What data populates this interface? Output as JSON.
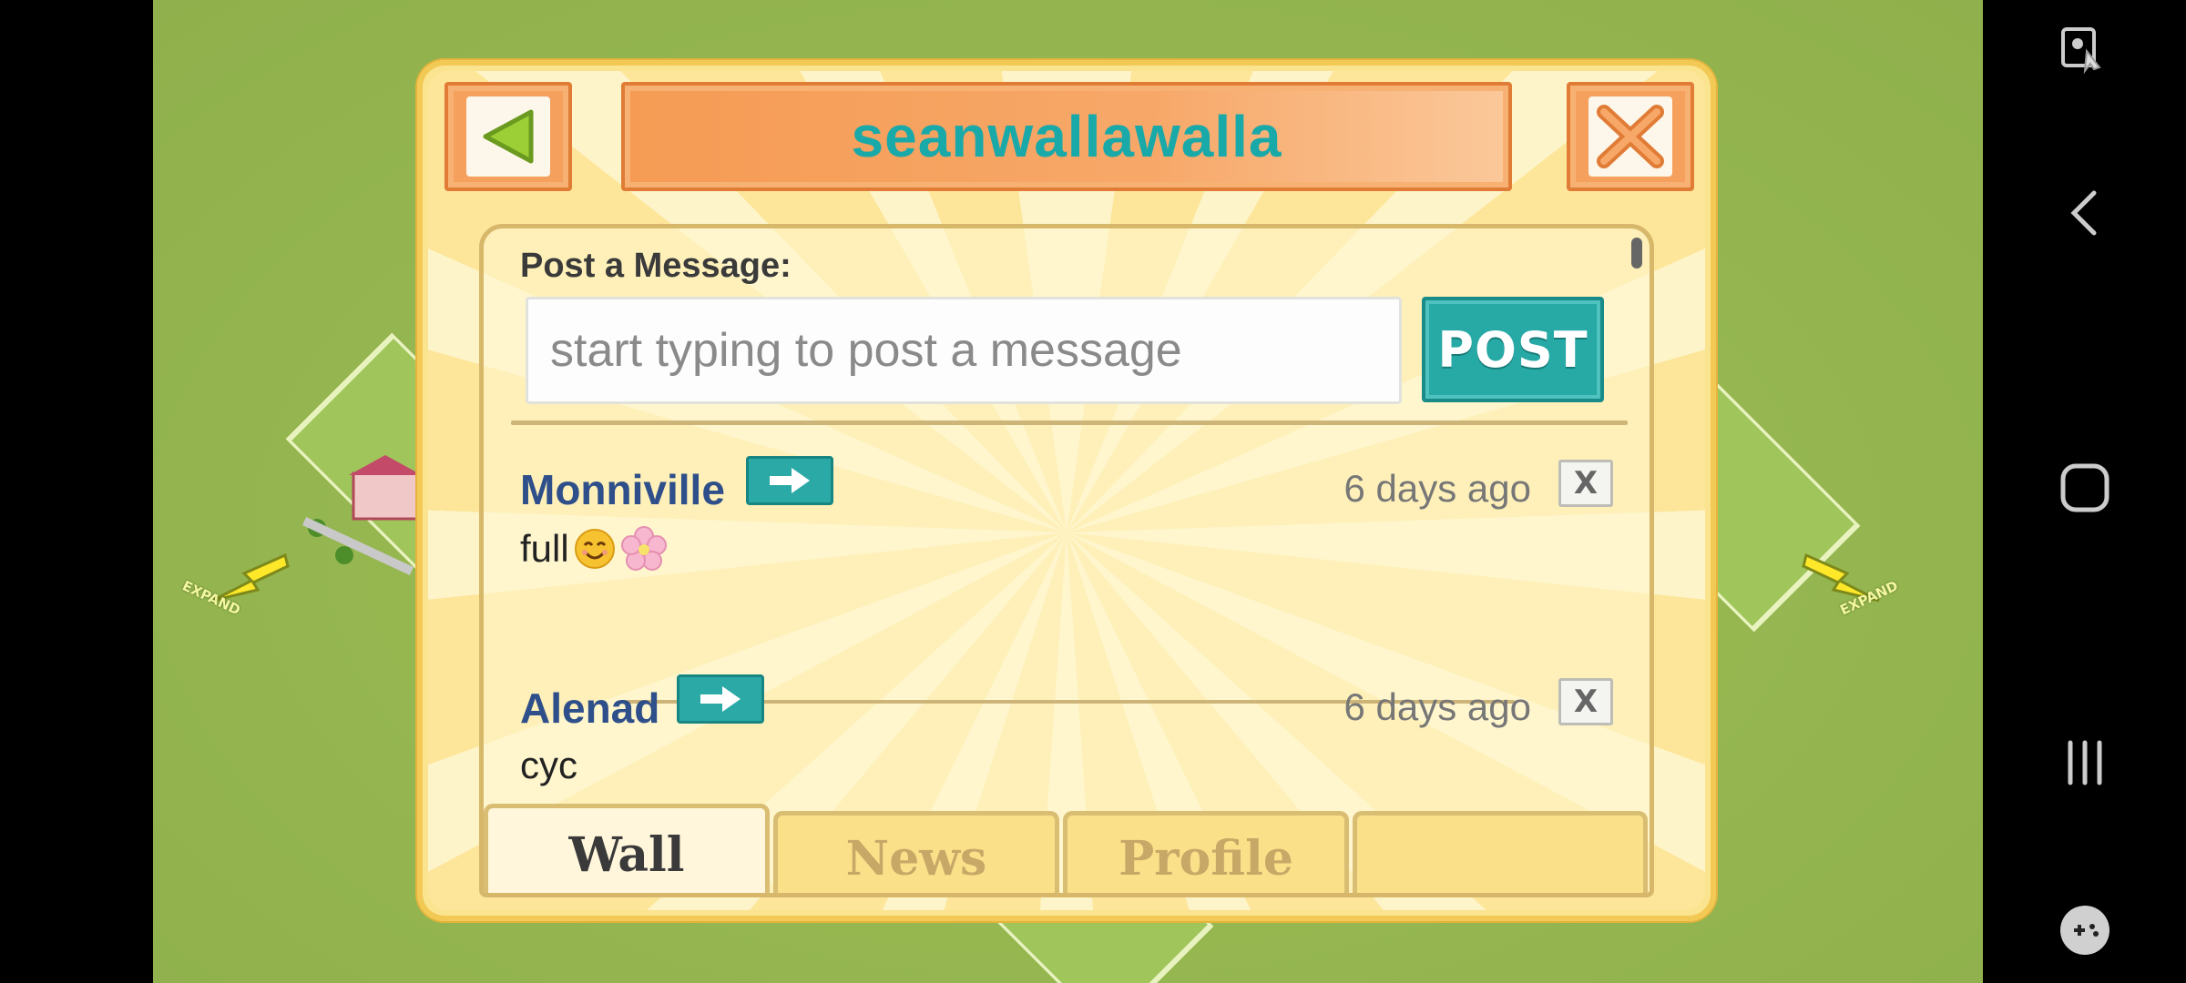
{
  "dialog": {
    "title": "seanwallawalla",
    "post_label": "Post a Message:",
    "input_placeholder": "start typing to post a message",
    "post_button": "POST"
  },
  "posts": [
    {
      "author": "Monniville",
      "time": "6 days ago",
      "message": "full",
      "delete_label": "X"
    },
    {
      "author": "Alenad",
      "time": "6 days ago",
      "message": "cyc",
      "delete_label": "X"
    }
  ],
  "tabs": [
    {
      "label": "Wall",
      "active": true
    },
    {
      "label": "News",
      "active": false
    },
    {
      "label": "Profile",
      "active": false
    },
    {
      "label": "",
      "active": false
    }
  ],
  "map": {
    "expand_label": "EXPAND"
  },
  "colors": {
    "accent_teal": "#19a9a9",
    "author_blue": "#2e4f8a",
    "frame_orange": "#f59b54",
    "panel_yellow": "#fbe48f"
  },
  "icons": [
    "back-arrow-icon",
    "close-icon",
    "right-arrow-icon",
    "smile-emoji-icon",
    "cherry-blossom-emoji-icon",
    "accessibility-icon",
    "nav-back-icon",
    "nav-home-icon",
    "nav-recents-icon",
    "game-tools-icon"
  ]
}
